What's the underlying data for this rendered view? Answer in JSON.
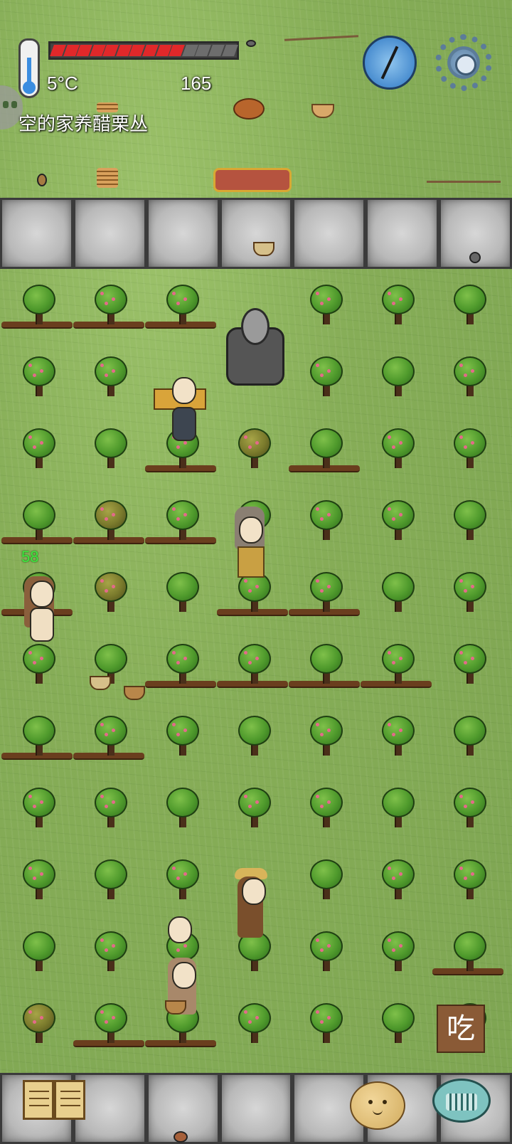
{
  "hud": {
    "temperature": "5°C",
    "yum_count": "165",
    "hover_label": "空的家养醋栗丛",
    "food_pips_total": 14,
    "food_pips_filled": 10
  },
  "player": {
    "age": "58"
  },
  "buttons": {
    "eat_label": "吃",
    "tech_book": "book-icon",
    "emote": "emote-face-icon",
    "keyboard": "keyboard-icon",
    "settings": "gear-icon",
    "compass": "compass-icon"
  },
  "colors": {
    "food_full": "#e0282a",
    "food_empty": "#6d6d6d",
    "age_label": "#3ee93e",
    "grass": "#8ab25a",
    "stone": "#b9b9b9"
  }
}
